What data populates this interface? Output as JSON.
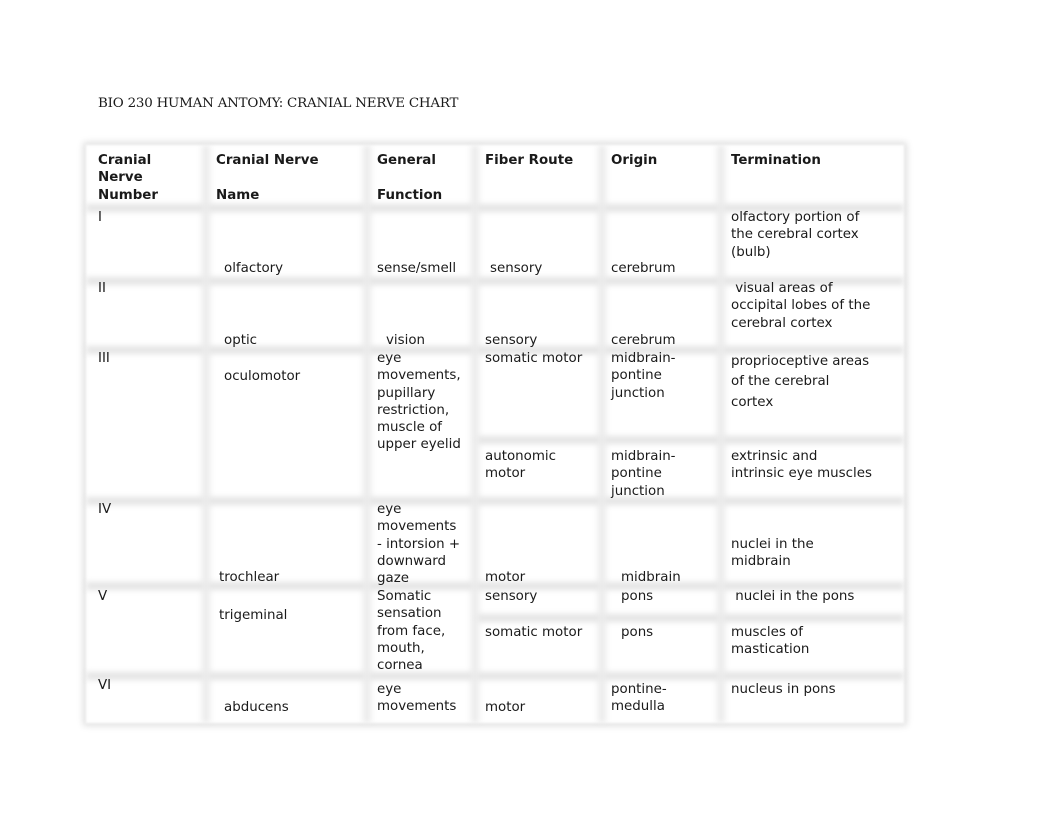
{
  "document": {
    "title": "BIO 230 HUMAN ANTOMY: CRANIAL NERVE CHART"
  },
  "table": {
    "headers": {
      "number": "Cranial\nNerve\nNumber",
      "name": "Cranial Nerve\n\nName",
      "function": "General\n\nFunction",
      "fiber_route": "Fiber Route",
      "origin": "Origin",
      "termination": "Termination"
    },
    "rows": [
      {
        "number": "I",
        "name": "olfactory",
        "function": "sense/smell",
        "fiber_route": "sensory",
        "origin": "cerebrum",
        "termination": "olfactory portion of\nthe cerebral cortex\n(bulb)"
      },
      {
        "number": "II",
        "name": "optic",
        "function": "vision",
        "fiber_route": "sensory",
        "origin": "cerebrum",
        "termination": " visual areas of\noccipital lobes of the\ncerebral cortex"
      },
      {
        "number": "III",
        "name": "oculomotor",
        "function": "eye\nmovements,\npupillary\nrestriction,\nmuscle of\nupper eyelid",
        "sub_rows": [
          {
            "fiber_route": "somatic motor",
            "origin": "midbrain-\npontine\njunction",
            "termination": "proprioceptive areas\nof the cerebral\ncortex"
          },
          {
            "fiber_route": "autonomic\nmotor",
            "origin": "midbrain-\npontine\njunction",
            "termination": "extrinsic and\nintrinsic eye muscles"
          }
        ]
      },
      {
        "number": "IV",
        "name": "trochlear",
        "function": "eye\nmovements\n- intorsion +\ndownward\ngaze",
        "fiber_route": "motor",
        "origin": "midbrain",
        "termination": "nuclei in the\nmidbrain"
      },
      {
        "number": "V",
        "name": "trigeminal",
        "function": "Somatic\nsensation\nfrom face,\nmouth,\ncornea",
        "sub_rows": [
          {
            "fiber_route": "sensory",
            "origin": "pons",
            "termination": " nuclei in the pons"
          },
          {
            "fiber_route": "somatic motor",
            "origin": "pons",
            "termination": "muscles of\nmastication"
          }
        ]
      },
      {
        "number": "VI",
        "name": "abducens",
        "function": "eye\nmovements",
        "fiber_route": "motor",
        "origin": "pontine-\nmedulla",
        "termination": "nucleus in pons"
      }
    ]
  }
}
